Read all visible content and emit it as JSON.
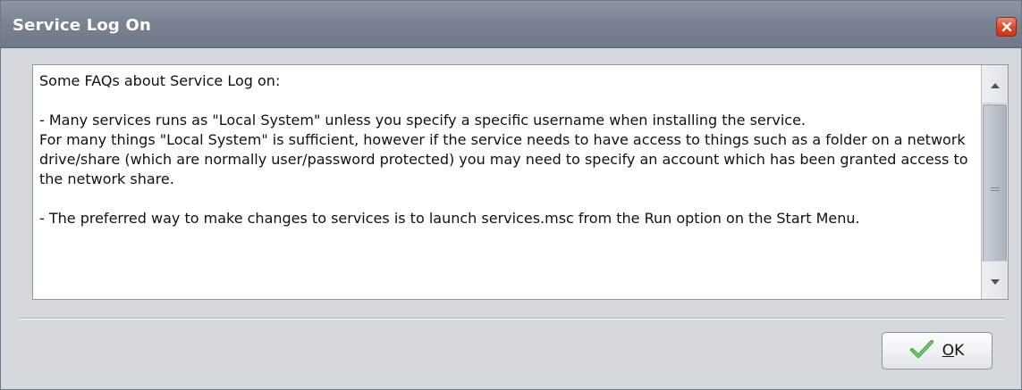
{
  "window": {
    "title": "Service Log On"
  },
  "content": {
    "text": "Some FAQs about Service Log on:\n\n- Many services runs as \"Local System\" unless you specify a specific username when installing the service.\nFor many things \"Local System\" is sufficient, however if the service needs to have access to things such as a folder on a network drive/share (which are normally user/password protected) you may need to specify an account which has been granted access to the network share.\n\n- The preferred way to make changes to services is to launch services.msc from the Run option on the Start Menu."
  },
  "buttons": {
    "ok": {
      "mnemonic": "O",
      "rest": "K"
    }
  },
  "icons": {
    "close": "close-icon",
    "ok": "checkmark-icon",
    "scroll_up": "arrow-up-icon",
    "scroll_down": "arrow-down-icon"
  },
  "colors": {
    "title_bar": "#7b8493",
    "close_button": "#d9472b",
    "check": "#3ea43a"
  }
}
